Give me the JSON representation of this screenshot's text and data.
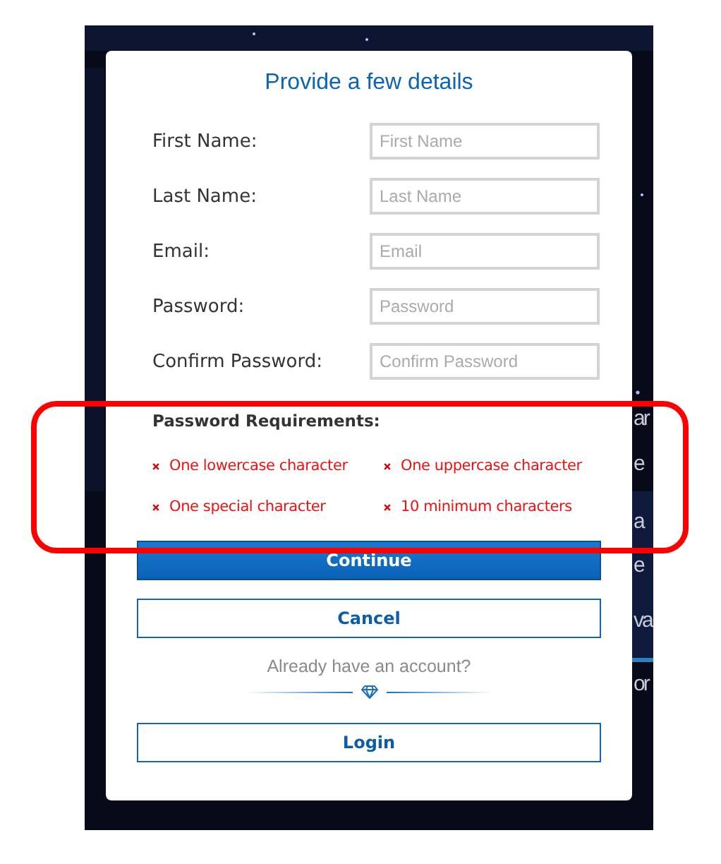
{
  "background_text": [
    "ar",
    "e",
    "a",
    "e",
    "va",
    "or"
  ],
  "dialog": {
    "title": "Provide a few details",
    "fields": [
      {
        "label": "First Name:",
        "placeholder": "First Name"
      },
      {
        "label": "Last Name:",
        "placeholder": "Last Name"
      },
      {
        "label": "Email:",
        "placeholder": "Email"
      },
      {
        "label": "Password:",
        "placeholder": "Password"
      },
      {
        "label": "Confirm Password:",
        "placeholder": "Confirm Password"
      }
    ],
    "requirements_title": "Password Requirements:",
    "requirements": [
      {
        "text": "One lowercase character",
        "met": false
      },
      {
        "text": "One uppercase character",
        "met": false
      },
      {
        "text": "One special character",
        "met": false
      },
      {
        "text": "10 minimum characters",
        "met": false
      }
    ],
    "buttons": [
      {
        "label": "Continue",
        "kind": "primary"
      },
      {
        "label": "Cancel",
        "kind": "outline"
      }
    ],
    "login_prompt": "Already have an account?",
    "login_button": {
      "label": "Login"
    }
  },
  "annotations": [
    {
      "kind": "rounded-frame"
    }
  ]
}
